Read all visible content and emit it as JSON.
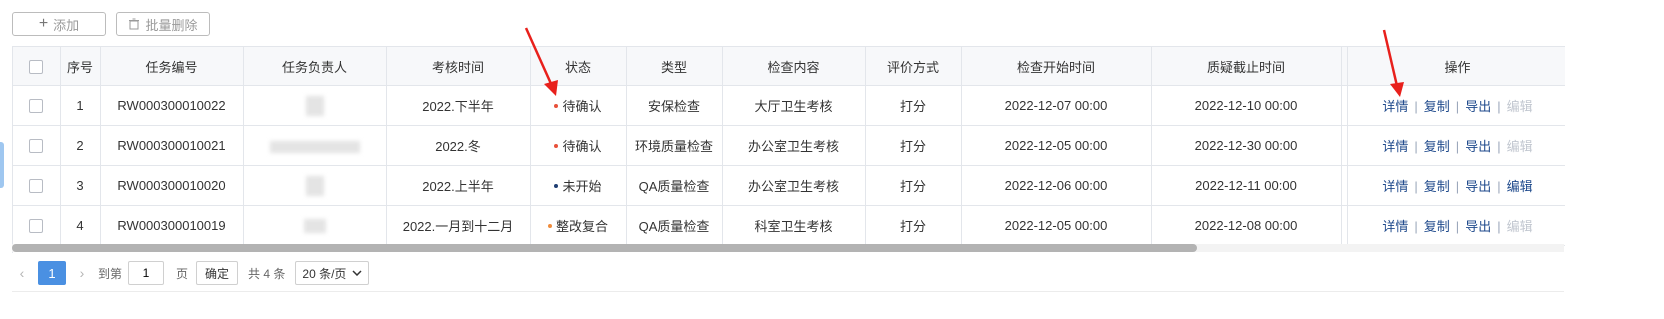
{
  "toolbar": {
    "add_label": "添加",
    "batch_delete_label": "批量删除"
  },
  "table": {
    "headers": {
      "index": "序号",
      "task_no": "任务编号",
      "owner": "任务负责人",
      "period": "考核时间",
      "status": "状态",
      "type": "类型",
      "content": "检查内容",
      "eval": "评价方式",
      "start": "检查开始时间",
      "deadline": "质疑截止时间",
      "actions": "操作"
    },
    "rows": [
      {
        "index": "1",
        "task_no": "RW000300010022",
        "period": "2022.下半年",
        "status": "待确认",
        "status_color": "#e8503a",
        "type": "安保检查",
        "content": "大厅卫生考核",
        "eval": "打分",
        "start": "2022-12-07 00:00",
        "deadline": "2022-12-10 00:00"
      },
      {
        "index": "2",
        "task_no": "RW000300010021",
        "period": "2022.冬",
        "status": "待确认",
        "status_color": "#e8503a",
        "type": "环境质量检查",
        "content": "办公室卫生考核",
        "eval": "打分",
        "start": "2022-12-05 00:00",
        "deadline": "2022-12-30 00:00"
      },
      {
        "index": "3",
        "task_no": "RW000300010020",
        "period": "2022.上半年",
        "status": "未开始",
        "status_color": "#1f3e73",
        "type": "QA质量检查",
        "content": "办公室卫生考核",
        "eval": "打分",
        "start": "2022-12-06 00:00",
        "deadline": "2022-12-11 00:00"
      },
      {
        "index": "4",
        "task_no": "RW000300010019",
        "period": "2022.一月到十二月",
        "status": "整改复合",
        "status_color": "#f08c3c",
        "type": "QA质量检查",
        "content": "科室卫生考核",
        "eval": "打分",
        "start": "2022-12-05 00:00",
        "deadline": "2022-12-08 00:00"
      }
    ],
    "actions": {
      "detail": "详情",
      "copy": "复制",
      "export": "导出",
      "edit": "编辑"
    }
  },
  "pager": {
    "prev": "‹",
    "next": "›",
    "current": "1",
    "goto_label": "到第",
    "goto_value": "1",
    "page_unit": "页",
    "confirm": "确定",
    "total": "共 4 条",
    "page_size": "20 条/页"
  },
  "colors": {
    "accent": "#4a90e2",
    "link": "#1f4a8c",
    "annotation_arrow": "#e8201c"
  },
  "icons": [
    "plus-icon",
    "trash-icon",
    "chevron-down-icon",
    "chevron-left-icon",
    "chevron-right-icon"
  ]
}
